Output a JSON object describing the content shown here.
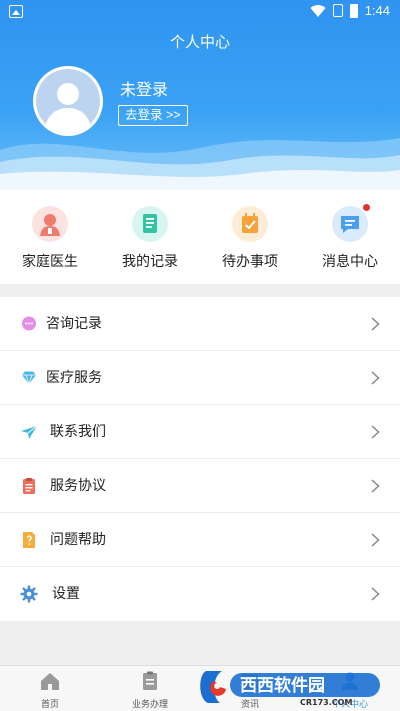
{
  "statusbar": {
    "time": "1:44"
  },
  "header": {
    "title": "个人中心"
  },
  "profile": {
    "status": "未登录",
    "login_button": "去登录 >>"
  },
  "quick_actions": [
    {
      "label": "家庭医生",
      "icon": "doctor-icon"
    },
    {
      "label": "我的记录",
      "icon": "record-icon"
    },
    {
      "label": "待办事项",
      "icon": "todo-icon"
    },
    {
      "label": "消息中心",
      "icon": "message-icon",
      "badge": true
    }
  ],
  "menu": [
    {
      "label": "咨询记录",
      "icon": "chat-bubble-icon"
    },
    {
      "label": "医疗服务",
      "icon": "diamond-icon"
    },
    {
      "label": "联系我们",
      "icon": "paper-plane-icon"
    },
    {
      "label": "服务协议",
      "icon": "agreement-icon"
    },
    {
      "label": "问题帮助",
      "icon": "help-document-icon"
    },
    {
      "label": "设置",
      "icon": "gear-icon"
    }
  ],
  "bottom_nav": [
    {
      "label": "首页",
      "icon": "home-icon"
    },
    {
      "label": "业务办理",
      "icon": "business-icon"
    },
    {
      "label": "资讯",
      "icon": "news-icon"
    },
    {
      "label": "个人中心",
      "icon": "person-icon"
    }
  ],
  "watermark": {
    "text": "西西软件园",
    "url_text": "CR173.COM"
  },
  "colors": {
    "primary": "#2f93f0",
    "badge": "#e0342f"
  }
}
